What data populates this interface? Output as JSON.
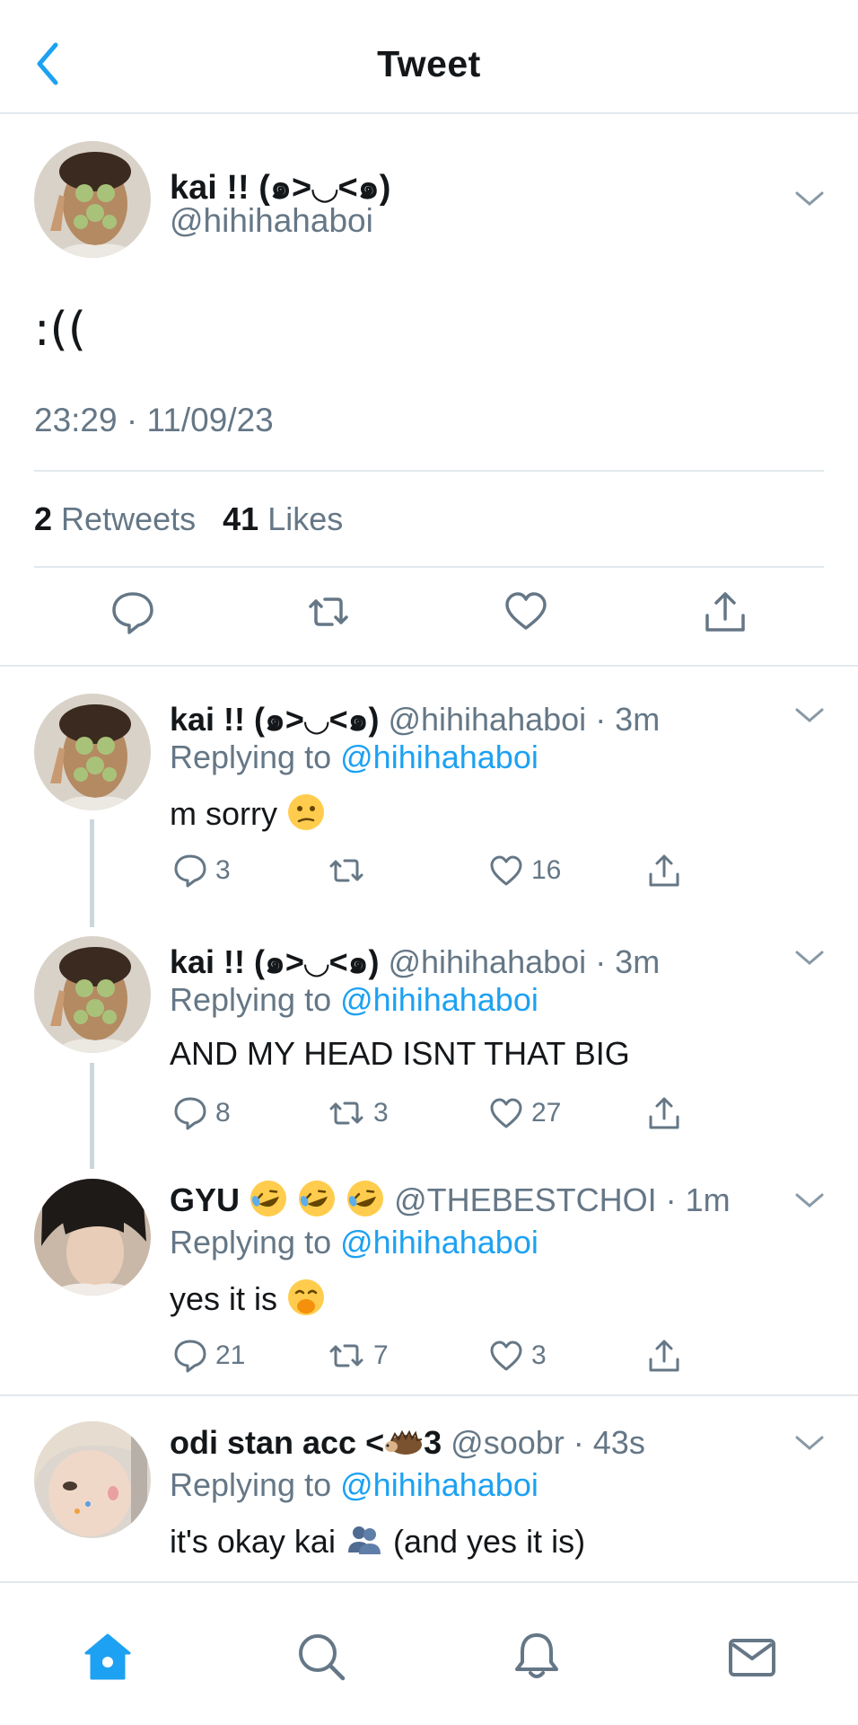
{
  "header": {
    "title": "Tweet"
  },
  "main_tweet": {
    "name": "kai !! (๑>◡<๑)",
    "handle": "@hihihahaboi",
    "text": ":((",
    "timestamp": "23:29 · 11/09/23",
    "retweet_count": "2",
    "retweet_label": "Retweets",
    "like_count": "41",
    "like_label": "Likes"
  },
  "replies": [
    {
      "name": "kai !! (๑>◡<๑)",
      "handle": "@hihihahaboi",
      "time": "· 3m",
      "replying_label": "Replying to",
      "replying_to": "@hihihahaboi",
      "text": "m sorry",
      "comments": "3",
      "retweets": "",
      "likes": "16"
    },
    {
      "name": "kai !! (๑>◡<๑)",
      "handle": "@hihihahaboi",
      "time": "· 3m",
      "replying_label": "Replying to",
      "replying_to": "@hihihahaboi",
      "text": "AND MY HEAD ISNT THAT BIG",
      "comments": "8",
      "retweets": "3",
      "likes": "27"
    },
    {
      "name": "GYU",
      "handle": "@THEBESTCHOI",
      "time": "· 1m",
      "replying_label": "Replying to",
      "replying_to": "@hihihahaboi",
      "text": "yes it is",
      "comments": "21",
      "retweets": "7",
      "likes": "3"
    },
    {
      "name": "odi stan acc <",
      "name_suffix": "3",
      "handle": "@soobr",
      "time": "· 43s",
      "replying_label": "Replying to",
      "replying_to": "@hihihahaboi",
      "text_before": "it's okay kai",
      "text_after": "(and yes it is)"
    }
  ],
  "tabs": [
    "home-icon",
    "search-icon",
    "notifications-icon",
    "messages-icon"
  ],
  "colors": {
    "accent": "#1da1f2",
    "secondary": "#657786",
    "border": "#e1e8ed"
  }
}
